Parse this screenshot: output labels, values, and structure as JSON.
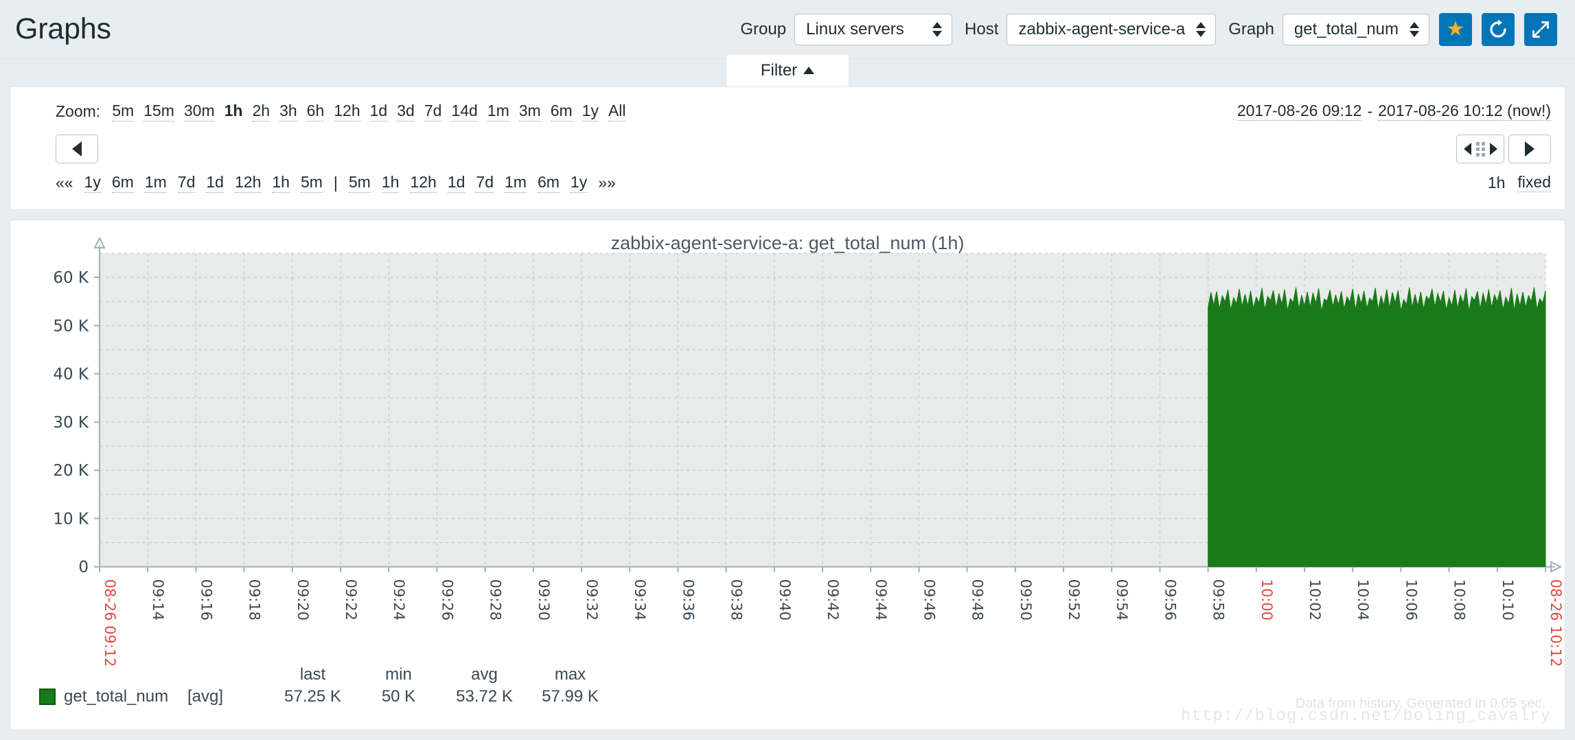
{
  "header": {
    "title": "Graphs",
    "group_label": "Group",
    "group_value": "Linux servers",
    "host_label": "Host",
    "host_value": "zabbix-agent-service-a",
    "graph_label": "Graph",
    "graph_value": "get_total_num",
    "favorite_icon": "star-icon",
    "refresh_icon": "refresh-icon",
    "fullscreen_icon": "fullscreen-icon",
    "accent_color": "#0275b8",
    "star_color": "#f5b32a"
  },
  "filter": {
    "tab_label": "Filter",
    "tab_caret": "caret-up-icon"
  },
  "timebar": {
    "zoom_label": "Zoom:",
    "zoom_links": [
      "5m",
      "15m",
      "30m",
      "1h",
      "2h",
      "3h",
      "6h",
      "12h",
      "1d",
      "3d",
      "7d",
      "14d",
      "1m",
      "3m",
      "6m",
      "1y",
      "All"
    ],
    "zoom_active": "1h",
    "range_from": "2017-08-26 09:12",
    "range_sep": "-",
    "range_to": "2017-08-26 10:12 (now!)",
    "nav_left_icon": "arrow-left-icon",
    "nav_grab_icon": "drag-handle-icon",
    "nav_right_icon": "arrow-right-icon",
    "quick_prefix": "««",
    "quick_back": [
      "1y",
      "6m",
      "1m",
      "7d",
      "1d",
      "12h",
      "1h",
      "5m"
    ],
    "quick_sep": "|",
    "quick_fwd": [
      "5m",
      "1h",
      "12h",
      "1d",
      "7d",
      "1m",
      "6m",
      "1y"
    ],
    "quick_suffix": "»»",
    "period_label": "1h",
    "fixed_label": "fixed"
  },
  "graph": {
    "title": "zabbix-agent-service-a: get_total_num (1h)",
    "legend_headers": [
      "last",
      "min",
      "avg",
      "max"
    ],
    "series_name": "get_total_num",
    "series_agg": "[avg]",
    "series_values": [
      "57.25 K",
      "50 K",
      "53.72 K",
      "57.99 K"
    ],
    "series_color": "#1a7a1a",
    "footer_note": "Data from history. Generated in 0.05 sec.",
    "watermark": "http://blog.csdn.net/boling_cavalry"
  },
  "chart_data": {
    "type": "area",
    "title": "zabbix-agent-service-a: get_total_num (1h)",
    "xlabel": "",
    "ylabel": "",
    "ylim": [
      0,
      65000
    ],
    "yticks": [
      0,
      10000,
      20000,
      30000,
      40000,
      50000,
      60000
    ],
    "ytick_labels": [
      "0",
      "10 K",
      "20 K",
      "30 K",
      "40 K",
      "50 K",
      "60 K"
    ],
    "grid": true,
    "legend_position": "bottom-left",
    "x_start_label": "08-26 09:12",
    "x_end_label": "08-26 10:12",
    "x_highlight_label": "10:00",
    "xtick_labels": [
      "08-26 09:12",
      "09:14",
      "09:16",
      "09:18",
      "09:20",
      "09:22",
      "09:24",
      "09:26",
      "09:28",
      "09:30",
      "09:32",
      "09:34",
      "09:36",
      "09:38",
      "09:40",
      "09:42",
      "09:44",
      "09:46",
      "09:48",
      "09:50",
      "09:52",
      "09:54",
      "09:56",
      "09:58",
      "10:00",
      "10:02",
      "10:04",
      "10:06",
      "10:08",
      "10:10",
      "10:12",
      "08-26 10:12"
    ],
    "series": [
      {
        "name": "get_total_num",
        "aggregation": "avg",
        "color": "#1a7a1a",
        "last": 57250,
        "min": 50000,
        "avg": 53720,
        "max": 57990,
        "data_start_time": "10:00",
        "data_end_time": "10:12",
        "note": "No data before 10:00; from 10:00 onward values fluctuate between ~50 K and ~58 K",
        "values": [
          53800,
          56900,
          54200,
          57100,
          53500,
          56200,
          54900,
          57400,
          53200,
          55800,
          54500,
          57600,
          53900,
          56500,
          54100,
          57200,
          53600,
          55900,
          54700,
          57800,
          53300,
          56100,
          55200,
          57300,
          53700,
          56700,
          54400,
          57500,
          53100,
          55600,
          54800,
          57900,
          53400,
          56300,
          54000,
          57000,
          53800,
          56800,
          54600,
          57700,
          53000,
          55500,
          55100,
          57400,
          53900,
          56400,
          54300,
          57100,
          53500,
          56000,
          54900,
          57600,
          53200,
          56600,
          54500,
          57200,
          53600,
          55700,
          55000,
          57800,
          53300,
          56200,
          54200,
          57500,
          53700,
          56900,
          54700,
          57300,
          53100,
          55400,
          54400,
          57900,
          53800,
          56500,
          54000,
          57000,
          53400,
          56100,
          55300,
          57600,
          53900,
          56700,
          54800,
          57200,
          53200,
          55800,
          54100,
          57400,
          53600,
          56300,
          54600,
          57700,
          53000,
          56000,
          55200,
          57100,
          53500,
          56800,
          54300,
          57500,
          53700,
          56400,
          54900,
          57300,
          53300,
          55900,
          54500,
          57800,
          53100,
          56600,
          54000,
          57000,
          53800,
          56200,
          55000,
          57900,
          53400,
          55600,
          54700,
          57250
        ]
      }
    ]
  }
}
